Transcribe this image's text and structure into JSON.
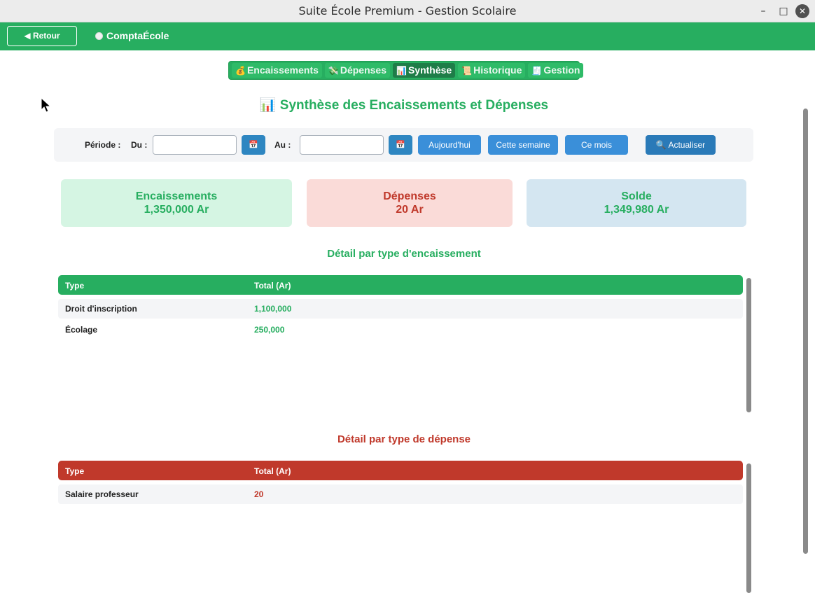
{
  "window": {
    "title": "Suite École Premium - Gestion Scolaire"
  },
  "topbar": {
    "back_label": "◀ Retour",
    "brand": "ComptaÉcole"
  },
  "tabs": [
    {
      "icon": "💰",
      "label": "Encaissements",
      "active": false
    },
    {
      "icon": "💸",
      "label": "Dépenses",
      "active": false
    },
    {
      "icon": "📊",
      "label": "Synthèse",
      "active": true
    },
    {
      "icon": "📜",
      "label": "Historique",
      "active": false
    },
    {
      "icon": "🧾",
      "label": "Gestion",
      "active": false
    }
  ],
  "page_title": "📊 Synthèse des Encaissements et Dépenses",
  "filter": {
    "periode_label": "Période :",
    "du_label": "Du :",
    "du_value": "",
    "au_label": "Au :",
    "au_value": "",
    "calendar_icon": "📅",
    "today_label": "Aujourd'hui",
    "week_label": "Cette semaine",
    "month_label": "Ce mois",
    "refresh_label": "🔍 Actualiser"
  },
  "summary": {
    "encaissements": {
      "label": "Encaissements",
      "value": "1,350,000 Ar"
    },
    "depenses": {
      "label": "Dépenses",
      "value": "20 Ar"
    },
    "solde": {
      "label": "Solde",
      "value": "1,349,980 Ar"
    }
  },
  "encaissement_detail": {
    "title": "Détail par type d'encaissement",
    "headers": {
      "type": "Type",
      "total": "Total (Ar)"
    },
    "rows": [
      {
        "type": "Droit d'inscription",
        "total": "1,100,000"
      },
      {
        "type": "Écolage",
        "total": "250,000"
      }
    ]
  },
  "depense_detail": {
    "title": "Détail par type de dépense",
    "headers": {
      "type": "Type",
      "total": "Total (Ar)"
    },
    "rows": [
      {
        "type": "Salaire professeur",
        "total": "20"
      }
    ]
  },
  "colors": {
    "green": "#27ae60",
    "red": "#c0392b",
    "blue": "#3a8fd9"
  }
}
